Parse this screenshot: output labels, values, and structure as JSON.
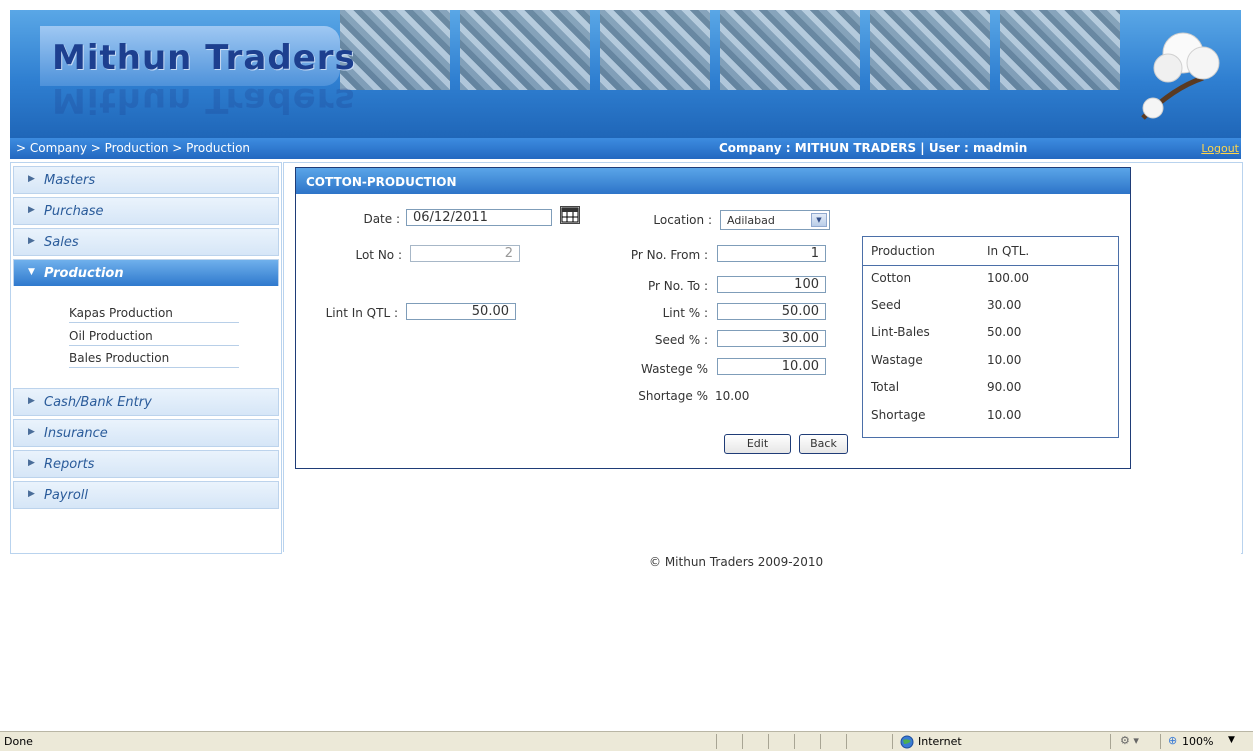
{
  "header": {
    "logo_text": "Mithun Traders"
  },
  "navbar": {
    "breadcrumb": "> Company > Production > Production",
    "company_info": "Company : MITHUN TRADERS |  User : madmin",
    "logout": "Logout"
  },
  "sidebar": {
    "items": [
      {
        "label": "Masters"
      },
      {
        "label": "Purchase"
      },
      {
        "label": "Sales"
      },
      {
        "label": "Production",
        "active": true
      },
      {
        "label": "Cash/Bank Entry"
      },
      {
        "label": "Insurance"
      },
      {
        "label": "Reports"
      },
      {
        "label": "Payroll"
      }
    ],
    "submenu": [
      {
        "label": "Kapas Production"
      },
      {
        "label": "Oil Production"
      },
      {
        "label": "Bales Production"
      }
    ]
  },
  "form": {
    "title": "COTTON-PRODUCTION",
    "date_label": "Date :",
    "date_value": "06/12/2011",
    "location_label": "Location :",
    "location_value": "Adilabad",
    "lot_no_label": "Lot No :",
    "lot_no_value": "2",
    "pr_no_from_label": "Pr No. From :",
    "pr_no_from_value": "1",
    "pr_no_to_label": "Pr No. To :",
    "pr_no_to_value": "100",
    "lint_in_qtl_label": "Lint In QTL :",
    "lint_in_qtl_value": "50.00",
    "lint_pct_label": "Lint % :",
    "lint_pct_value": "50.00",
    "seed_pct_label": "Seed % :",
    "seed_pct_value": "30.00",
    "wastege_label": "Wastege %",
    "wastege_value": "10.00",
    "shortage_label": "Shortage %",
    "shortage_value": "10.00",
    "edit_label": "Edit",
    "back_label": "Back"
  },
  "summary": {
    "header": [
      "Production",
      "In QTL."
    ],
    "rows": [
      [
        "Cotton",
        "100.00"
      ],
      [
        "Seed",
        "30.00"
      ],
      [
        "Lint-Bales",
        "50.00"
      ],
      [
        "Wastage",
        "10.00"
      ],
      [
        "Total",
        "90.00"
      ],
      [
        "Shortage",
        "10.00"
      ]
    ]
  },
  "footer": {
    "copyright": "© Mithun Traders 2009-2010"
  },
  "statusbar": {
    "status": "Done",
    "zone": "Internet",
    "zoom": "100%"
  }
}
